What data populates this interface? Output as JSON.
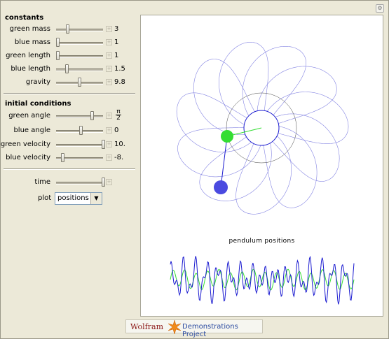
{
  "constants": {
    "title": "constants",
    "sliders": [
      {
        "label": "green mass",
        "value": "3",
        "position": 0.22
      },
      {
        "label": "blue mass",
        "value": "1",
        "position": 0.0
      },
      {
        "label": "green length",
        "value": "1",
        "position": 0.0
      },
      {
        "label": "blue length",
        "value": "1.5",
        "position": 0.2
      },
      {
        "label": "gravity",
        "value": "9.8",
        "position": 0.47
      }
    ]
  },
  "initial_conditions": {
    "title": "initial conditions",
    "sliders": [
      {
        "label": "green angle",
        "value_num": "π",
        "value_den": "2",
        "position": 0.75
      },
      {
        "label": "blue angle",
        "value": "0",
        "position": 0.5
      },
      {
        "label": "green velocity",
        "value": "10.",
        "position": 1.0
      },
      {
        "label": "blue velocity",
        "value": "-8.",
        "position": 0.1
      }
    ]
  },
  "time": {
    "label": "time",
    "position": 1.0
  },
  "plot": {
    "label": "plot",
    "selected": "positions"
  },
  "view": {
    "subplot_title": "pendulum positions",
    "green_color": "#33dd33",
    "blue_color": "#1a1ad0",
    "trace_color": "#5a5ad8"
  },
  "footer": {
    "brand": "Wolfram",
    "project": "Demonstrations Project"
  }
}
